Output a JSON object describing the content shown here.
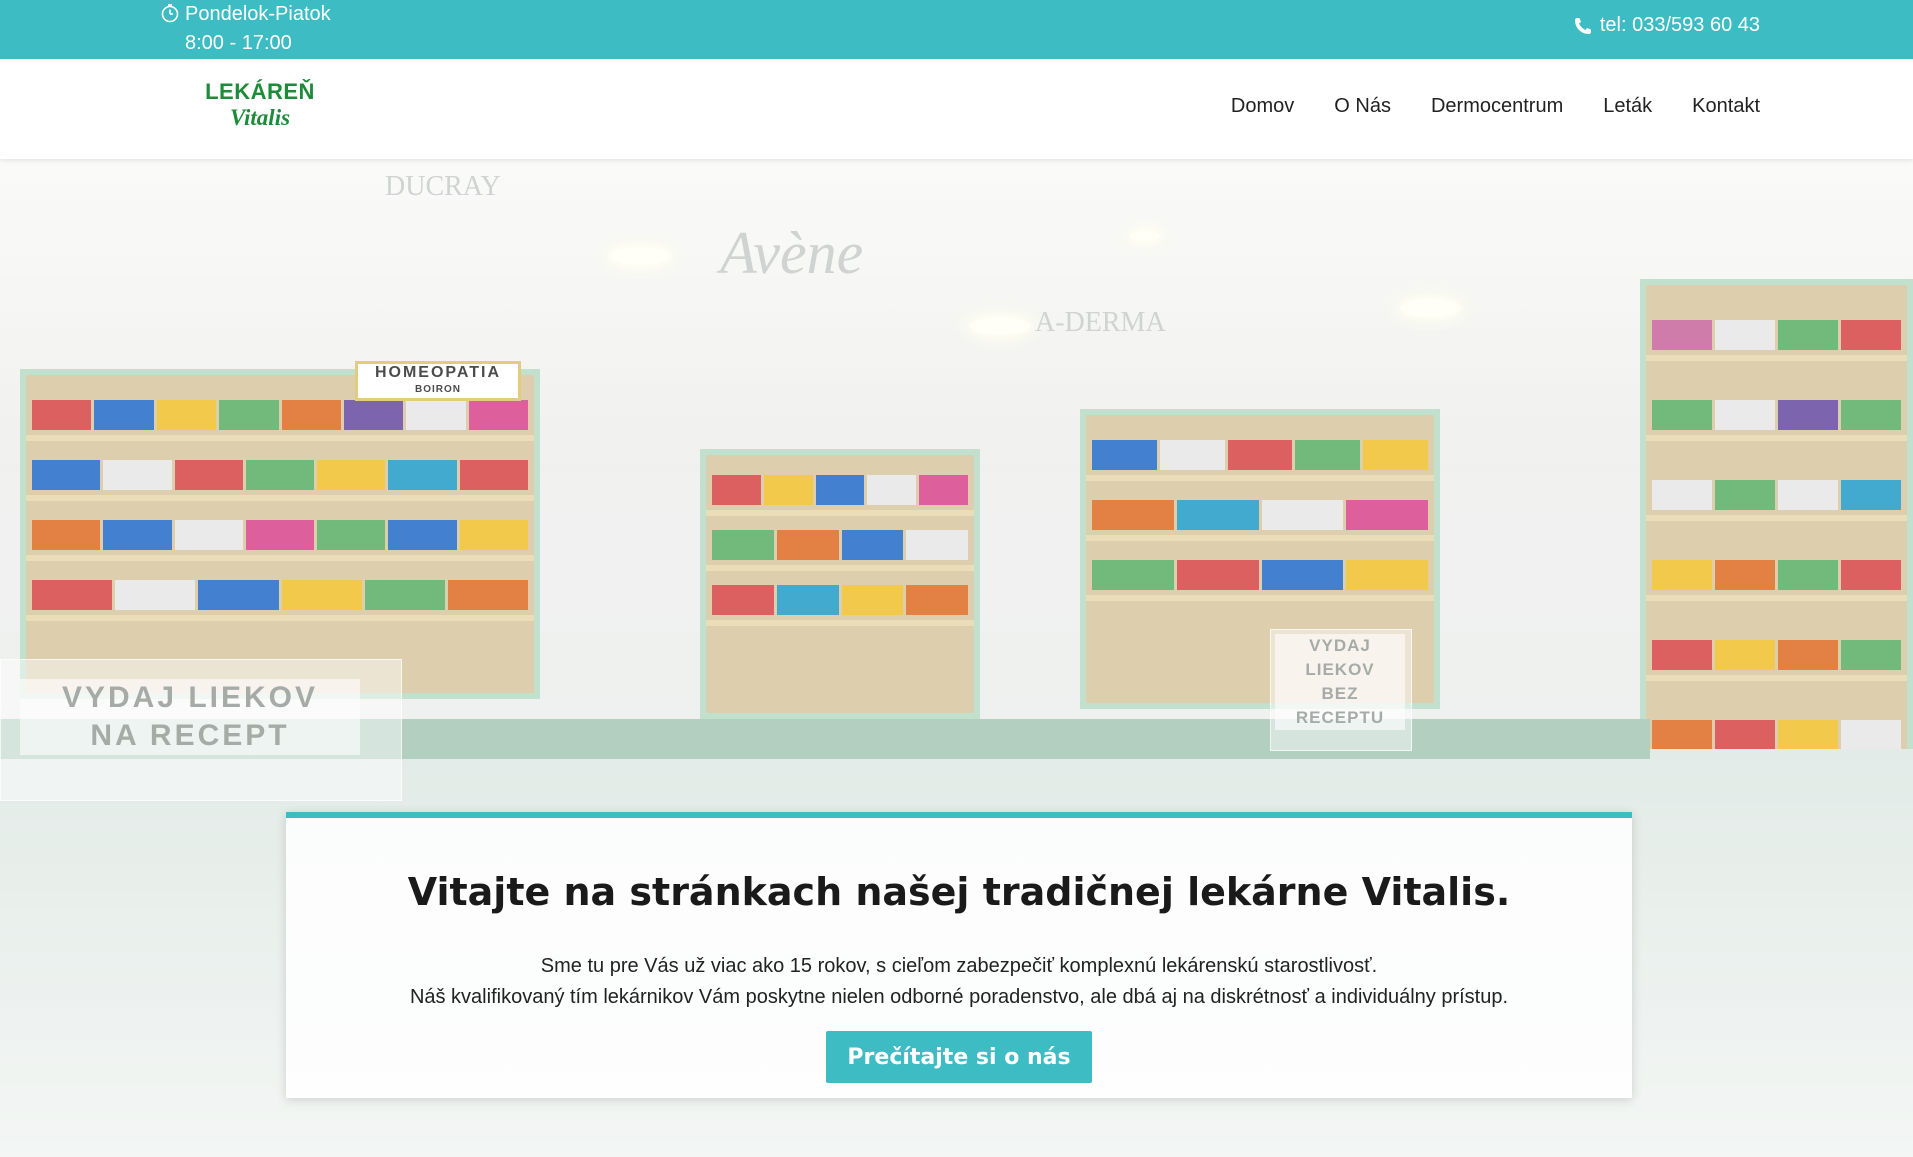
{
  "topbar": {
    "hours_line1": "Pondelok-Piatok",
    "hours_line2": "8:00 - 17:00",
    "phone": "tel: 033/593 60 43"
  },
  "logo": {
    "line1": "LEKÁREŇ",
    "line2": "Vitalis"
  },
  "nav": {
    "items": [
      {
        "label": "Domov"
      },
      {
        "label": "O Nás"
      },
      {
        "label": "Dermocentrum"
      },
      {
        "label": "Leták"
      },
      {
        "label": "Kontakt"
      }
    ]
  },
  "hero": {
    "signs": {
      "prescription": "VYDAJ LIEKOV\nNA RECEPT",
      "otc": "VYDAJ LIEKOV\nBEZ RECEPTU",
      "homeopatia": "HOMEOPATIA",
      "boiron": "BOIRON",
      "ducray": "DUCRAY",
      "avene": "Avène",
      "aderma": "A-DERMA"
    }
  },
  "welcome": {
    "title": "Vitajte na stránkach našej tradičnej lekárne Vitalis.",
    "line1": "Sme tu pre Vás už viac ako 15 rokov, s cieľom zabezpečiť komplexnú lekárenskú starostlivosť.",
    "line2": "Náš kvalifikovaný tím lekárnikov Vám poskytne nielen odborné poradenstvo, ale dbá aj na diskrétnosť a individuálny prístup.",
    "button": "Prečítajte si o nás"
  },
  "colors": {
    "accent": "#3dbdc3",
    "logo_green": "#1e8b3a"
  }
}
